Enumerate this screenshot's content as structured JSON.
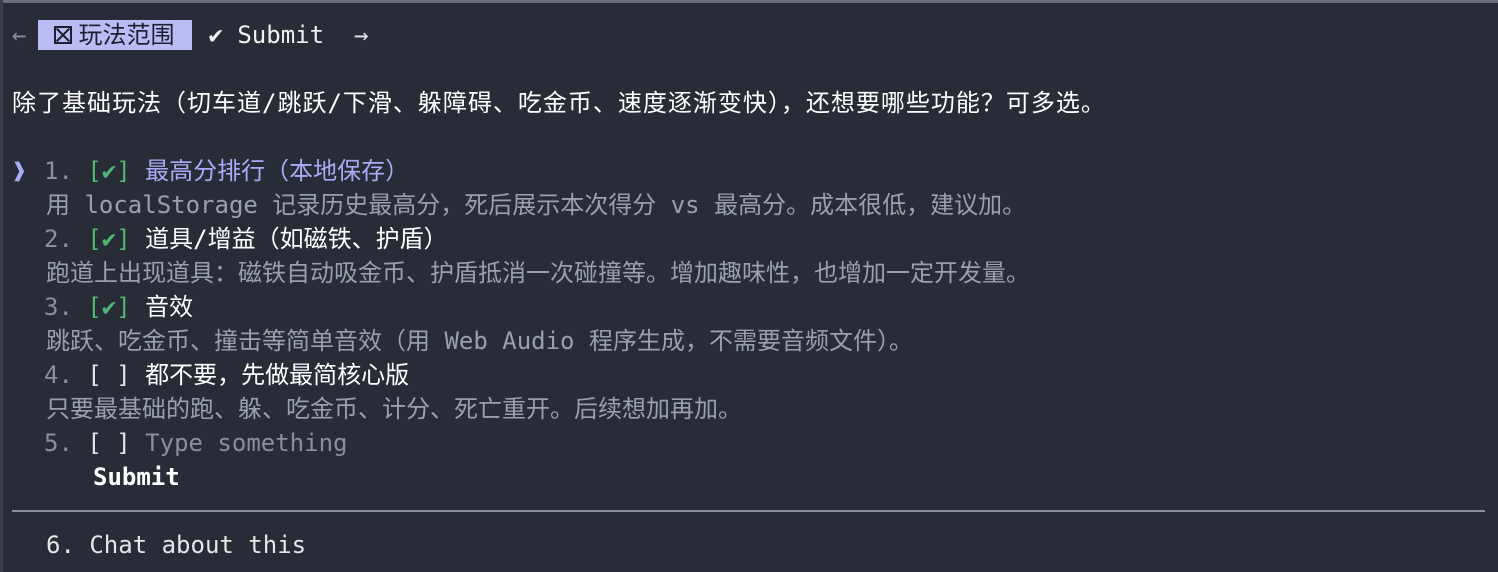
{
  "tabs": {
    "active_label": "玩法范围",
    "submit_label": "Submit"
  },
  "question": "除了基础玩法（切车道/跳跃/下滑、躲障碍、吃金币、速度逐渐变快），还想要哪些功能？可多选。",
  "cursor": "❱",
  "options": [
    {
      "num": "1.",
      "box": "[✔]",
      "label": "最高分排行（本地保存）",
      "desc": "用 localStorage 记录历史最高分，死后展示本次得分 vs 最高分。成本很低，建议加。",
      "checked": true
    },
    {
      "num": "2.",
      "box": "[✔]",
      "label": "道具/增益（如磁铁、护盾）",
      "desc": "跑道上出现道具：磁铁自动吸金币、护盾抵消一次碰撞等。增加趣味性，也增加一定开发量。",
      "checked": true
    },
    {
      "num": "3.",
      "box": "[✔]",
      "label": "音效",
      "desc": "跳跃、吃金币、撞击等简单音效（用 Web Audio 程序生成，不需要音频文件）。",
      "checked": true
    },
    {
      "num": "4.",
      "box": "[ ]",
      "label": "都不要，先做最简核心版",
      "desc": "只要最基础的跑、躲、吃金币、计分、死亡重开。后续想加再加。",
      "checked": false
    }
  ],
  "other": {
    "num": "5.",
    "box": "[ ]",
    "placeholder": "Type something"
  },
  "submit_button": "Submit",
  "chat": "6. Chat about this"
}
